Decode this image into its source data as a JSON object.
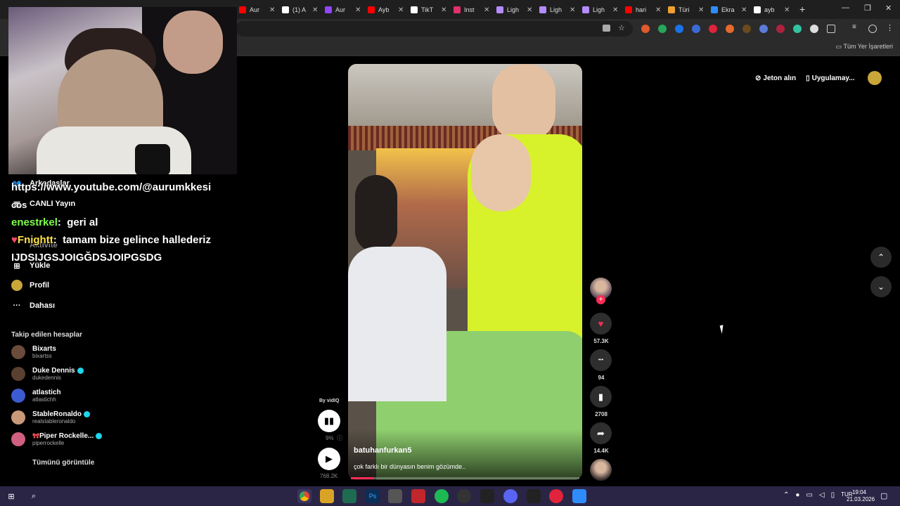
{
  "browser": {
    "tabs": [
      {
        "label": "Aur",
        "icon": "youtube-icon",
        "color": "#ff0000"
      },
      {
        "label": "(1) A",
        "icon": "tiktok-icon",
        "color": "#ffffff"
      },
      {
        "label": "Aur",
        "icon": "twitch-icon",
        "color": "#9146ff"
      },
      {
        "label": "Ayb",
        "icon": "youtube-icon",
        "color": "#ff0000"
      },
      {
        "label": "TikT",
        "icon": "tiktok-icon",
        "color": "#ffffff"
      },
      {
        "label": "Inst",
        "icon": "instagram-icon",
        "color": "#e1306c"
      },
      {
        "label": "Ligh",
        "icon": "pen-icon",
        "color": "#b48cff"
      },
      {
        "label": "Ligh",
        "icon": "pen-icon",
        "color": "#b48cff"
      },
      {
        "label": "Ligh",
        "icon": "pen-icon",
        "color": "#b48cff"
      },
      {
        "label": "hari",
        "icon": "youtube-icon",
        "color": "#ff0000"
      },
      {
        "label": "Türi",
        "icon": "crown-icon",
        "color": "#f0a030"
      },
      {
        "label": "Ekra",
        "icon": "cloud-icon",
        "color": "#2f8cff"
      },
      {
        "label": "ayb",
        "icon": "tiktok-icon",
        "color": "#ffffff"
      }
    ],
    "bookmarks_all": "Tüm Yer İşaretleri"
  },
  "sidebar": {
    "nav": [
      {
        "label": "Arkadaşlar",
        "icon": "friends-icon"
      },
      {
        "label": "CANLI Yayın",
        "icon": "live-icon"
      },
      {
        "label": "Aktivite",
        "icon": "activity-icon"
      },
      {
        "label": "Yükle",
        "icon": "upload-icon"
      },
      {
        "label": "Profil",
        "icon": "profile-icon"
      },
      {
        "label": "Dahası",
        "icon": "more-icon"
      }
    ],
    "following_title": "Takip edilen hesaplar",
    "accounts": [
      {
        "name": "Bixarts",
        "handle": "bixartss",
        "verified": false,
        "avatar_color": "#6b4b3a"
      },
      {
        "name": "Duke Dennis",
        "handle": "dukedennis",
        "verified": true,
        "avatar_color": "#5a4030"
      },
      {
        "name": "atlastich",
        "handle": "atlastichh",
        "verified": false,
        "avatar_color": "#3d5bd0"
      },
      {
        "name": "StableRonaldo",
        "handle": "realstableronaldo",
        "verified": true,
        "avatar_color": "#c89a7a"
      },
      {
        "name": "Piper Rockelle...",
        "handle": "piperrockelle",
        "verified": true,
        "avatar_color": "#d06080",
        "prefix": "🎀"
      }
    ],
    "see_all": "Tümünü görüntüle"
  },
  "stream_overlay": {
    "url_line": "https://www.youtube.com/@aurumkkesi",
    "short_line": "cos",
    "messages": [
      {
        "user": "enestrkel",
        "text": "geri al",
        "user_color": "#7dff4a",
        "badge": ""
      },
      {
        "user": "Fnightt",
        "text": "tamam bize gelince hallederiz",
        "user_color": "#ffe14a",
        "badge": "heart-badge-icon"
      }
    ],
    "continuation": "IJDSIJGSJOIGĞDSJOIPGSDG"
  },
  "video": {
    "author": "batuhanfurkan5",
    "caption": "çok farklı bir dünyasın benim gözümde..",
    "progress": 0.1,
    "actions": [
      {
        "name": "like",
        "icon": "heart-icon",
        "count": "57.3K",
        "color": "#fe2c55"
      },
      {
        "name": "comment",
        "icon": "comment-icon",
        "count": "94",
        "color": "#ffffff"
      },
      {
        "name": "save",
        "icon": "bookmark-icon",
        "count": "2708",
        "color": "#ffffff"
      },
      {
        "name": "share",
        "icon": "share-icon",
        "count": "14.4K",
        "color": "#ffffff"
      }
    ]
  },
  "vidiq": {
    "by_label": "By vidIQ",
    "percent": "9%",
    "views": "768.2K"
  },
  "top_right": {
    "coins": "Jeton alın",
    "app": "Uygulamay..."
  },
  "taskbar": {
    "lang": "TUR",
    "time": "19:04",
    "date": "21.03.2026"
  }
}
